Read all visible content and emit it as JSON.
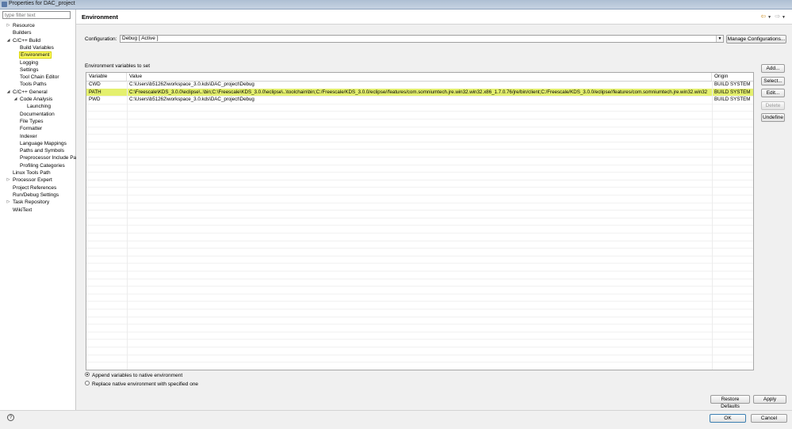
{
  "window": {
    "title": "Properties for DAC_project"
  },
  "sidebar": {
    "filter_placeholder": "type filter text",
    "nodes": [
      {
        "label": "Resource",
        "toggle": "▷"
      },
      {
        "label": "Builders",
        "toggle": ""
      },
      {
        "label": "C/C++ Build",
        "toggle": "◢"
      },
      {
        "label": "Build Variables",
        "toggle": ""
      },
      {
        "label": "Environment",
        "toggle": ""
      },
      {
        "label": "Logging",
        "toggle": ""
      },
      {
        "label": "Settings",
        "toggle": ""
      },
      {
        "label": "Tool Chain Editor",
        "toggle": ""
      },
      {
        "label": "Tools Paths",
        "toggle": ""
      },
      {
        "label": "C/C++ General",
        "toggle": "◢"
      },
      {
        "label": "Code Analysis",
        "toggle": "◢"
      },
      {
        "label": "Launching",
        "toggle": ""
      },
      {
        "label": "Documentation",
        "toggle": ""
      },
      {
        "label": "File Types",
        "toggle": ""
      },
      {
        "label": "Formatter",
        "toggle": ""
      },
      {
        "label": "Indexer",
        "toggle": ""
      },
      {
        "label": "Language Mappings",
        "toggle": ""
      },
      {
        "label": "Paths and Symbols",
        "toggle": ""
      },
      {
        "label": "Preprocessor Include Pa",
        "toggle": ""
      },
      {
        "label": "Profiling Categories",
        "toggle": ""
      },
      {
        "label": "Linux Tools Path",
        "toggle": ""
      },
      {
        "label": "Processor Expert",
        "toggle": "▷"
      },
      {
        "label": "Project References",
        "toggle": ""
      },
      {
        "label": "Run/Debug Settings",
        "toggle": ""
      },
      {
        "label": "Task Repository",
        "toggle": "▷"
      },
      {
        "label": "WikiText",
        "toggle": ""
      }
    ]
  },
  "header": {
    "title": "Environment",
    "back_icon": "arrow-left-icon",
    "forward_icon": "arrow-right-icon",
    "back_glyph": "⇦",
    "forward_glyph": "⇨",
    "dropdown_glyph": "▼"
  },
  "config": {
    "label": "Configuration:",
    "value": "Debug  [ Active ]",
    "arrow": "▼",
    "manage_label": "Manage Configurations..."
  },
  "env": {
    "label": "Environment variables to set",
    "columns": [
      "Variable",
      "Value",
      "Origin"
    ],
    "rows": [
      {
        "variable": "CWD",
        "value": "C:\\Users\\b51262\\workspace_3.0.kds\\DAC_project\\Debug",
        "origin": "BUILD SYSTEM"
      },
      {
        "variable": "PATH",
        "value": "C:\\Freescale\\KDS_3.0.0\\eclipse\\..\\bin;C:\\Freescale\\KDS_3.0.0\\eclipse\\..\\toolchain\\bin;C:/Freescale/KDS_3.0.0/eclipse//features/com.somniumtech.jre.win32.win32.x86_1.7.0.76/jre/bin/client;C:/Freescale/KDS_3.0.0/eclipse//features/com.somniumtech.jre.win32.win32",
        "origin": "BUILD SYSTEM"
      },
      {
        "variable": "PWD",
        "value": "C:\\Users\\b51262\\workspace_3.0.kds\\DAC_project\\Debug",
        "origin": "BUILD SYSTEM"
      }
    ],
    "selected_row": 1,
    "selected_color": "#e4f06e"
  },
  "side_buttons": {
    "add": "Add...",
    "select": "Select...",
    "edit": "Edit...",
    "delete": "Delete",
    "undefine": "Undefine"
  },
  "options": {
    "append": "Append variables to native environment",
    "replace": "Replace native environment with specified one",
    "selected": "append"
  },
  "footer": {
    "restore_defaults": "Restore Defaults",
    "apply": "Apply",
    "ok": "OK",
    "cancel": "Cancel",
    "help_icon": "help-icon",
    "help_glyph": "?"
  }
}
